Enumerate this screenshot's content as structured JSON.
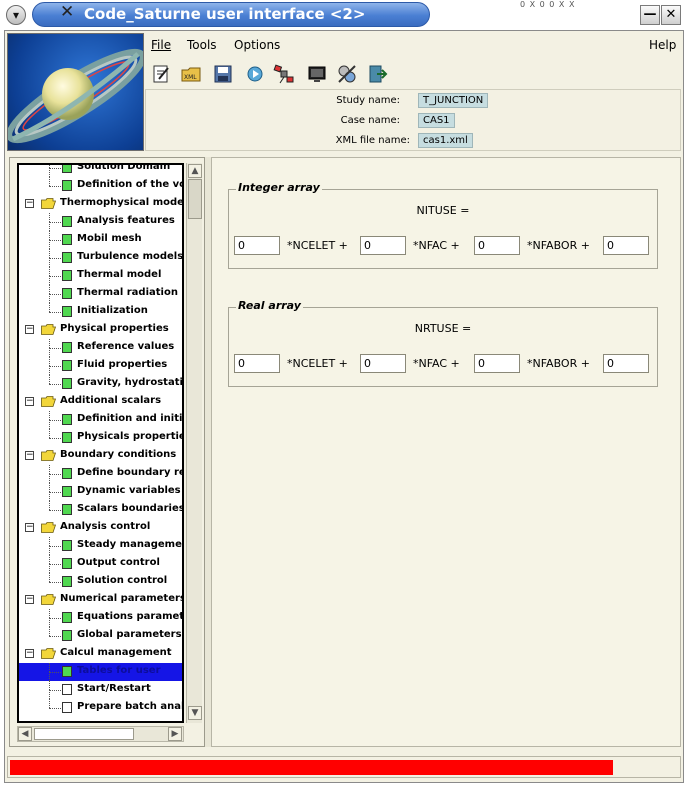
{
  "window": {
    "title": "Code_Saturne user interface <2>",
    "strip_text": "0 X 0 0 X X"
  },
  "menu": {
    "file": "File",
    "tools": "Tools",
    "options": "Options",
    "help": "Help"
  },
  "toolbar": {
    "icons": [
      "new-file-icon",
      "open-xml-icon",
      "save-icon",
      "run-icon",
      "satellite-icon",
      "monitor-icon",
      "tools-icon",
      "exit-icon"
    ]
  },
  "study": {
    "study_label": "Study name:",
    "study_value": "T_JUNCTION",
    "case_label": "Case name:",
    "case_value": "CAS1",
    "xml_label": "XML file name:",
    "xml_value": "cas1.xml"
  },
  "tree": {
    "rows": [
      {
        "label": "Solution Domain",
        "kind": "leaf",
        "level": 1
      },
      {
        "label": "Definition of the volu",
        "kind": "leaf",
        "level": 1
      },
      {
        "label": "Thermophysical models",
        "kind": "folder",
        "level": 0
      },
      {
        "label": "Analysis features",
        "kind": "leaf",
        "level": 1
      },
      {
        "label": "Mobil mesh",
        "kind": "leaf",
        "level": 1
      },
      {
        "label": "Turbulence models",
        "kind": "leaf",
        "level": 1
      },
      {
        "label": "Thermal model",
        "kind": "leaf",
        "level": 1
      },
      {
        "label": "Thermal radiation",
        "kind": "leaf",
        "level": 1
      },
      {
        "label": "Initialization",
        "kind": "leaf",
        "level": 1
      },
      {
        "label": "Physical properties",
        "kind": "folder",
        "level": 0
      },
      {
        "label": "Reference values",
        "kind": "leaf",
        "level": 1
      },
      {
        "label": "Fluid properties",
        "kind": "leaf",
        "level": 1
      },
      {
        "label": "Gravity, hydrostatic",
        "kind": "leaf",
        "level": 1
      },
      {
        "label": "Additional scalars",
        "kind": "folder",
        "level": 0
      },
      {
        "label": "Definition and initiali",
        "kind": "leaf",
        "level": 1
      },
      {
        "label": "Physicals properties",
        "kind": "leaf",
        "level": 1
      },
      {
        "label": "Boundary conditions",
        "kind": "folder",
        "level": 0
      },
      {
        "label": "Define boundary regi",
        "kind": "leaf",
        "level": 1
      },
      {
        "label": "Dynamic variables bo",
        "kind": "leaf",
        "level": 1
      },
      {
        "label": "Scalars boundaries",
        "kind": "leaf",
        "level": 1
      },
      {
        "label": "Analysis control",
        "kind": "folder",
        "level": 0
      },
      {
        "label": "Steady management",
        "kind": "leaf",
        "level": 1
      },
      {
        "label": "Output control",
        "kind": "leaf",
        "level": 1
      },
      {
        "label": "Solution control",
        "kind": "leaf",
        "level": 1
      },
      {
        "label": "Numerical parameters",
        "kind": "folder",
        "level": 0
      },
      {
        "label": "Equations parameter",
        "kind": "leaf",
        "level": 1
      },
      {
        "label": "Global parameters",
        "kind": "leaf",
        "level": 1
      },
      {
        "label": "Calcul management",
        "kind": "folder",
        "level": 0
      },
      {
        "label": "Tables for user",
        "kind": "leaf",
        "level": 1,
        "selected": true
      },
      {
        "label": "Start/Restart",
        "kind": "leaf-white",
        "level": 1
      },
      {
        "label": "Prepare batch analys",
        "kind": "leaf-white",
        "level": 1
      }
    ]
  },
  "integer_array": {
    "title": "Integer array",
    "header": "NITUSE =",
    "v1": "0",
    "op1": "*NCELET +",
    "v2": "0",
    "op2": "*NFAC +",
    "v3": "0",
    "op3": "*NFABOR +",
    "v4": "0"
  },
  "real_array": {
    "title": "Real array",
    "header": "NRTUSE =",
    "v1": "0",
    "op1": "*NCELET +",
    "v2": "0",
    "op2": "*NFAC +",
    "v3": "0",
    "op3": "*NFABOR +",
    "v4": "0"
  },
  "status": {
    "progress": 0.9,
    "progress_color": "#ff0000"
  },
  "colors": {
    "title_bar": "#4a7fd3",
    "window_bg": "#f3f1e3",
    "selection": "#1515e6",
    "leaf_green": "#50d850"
  }
}
